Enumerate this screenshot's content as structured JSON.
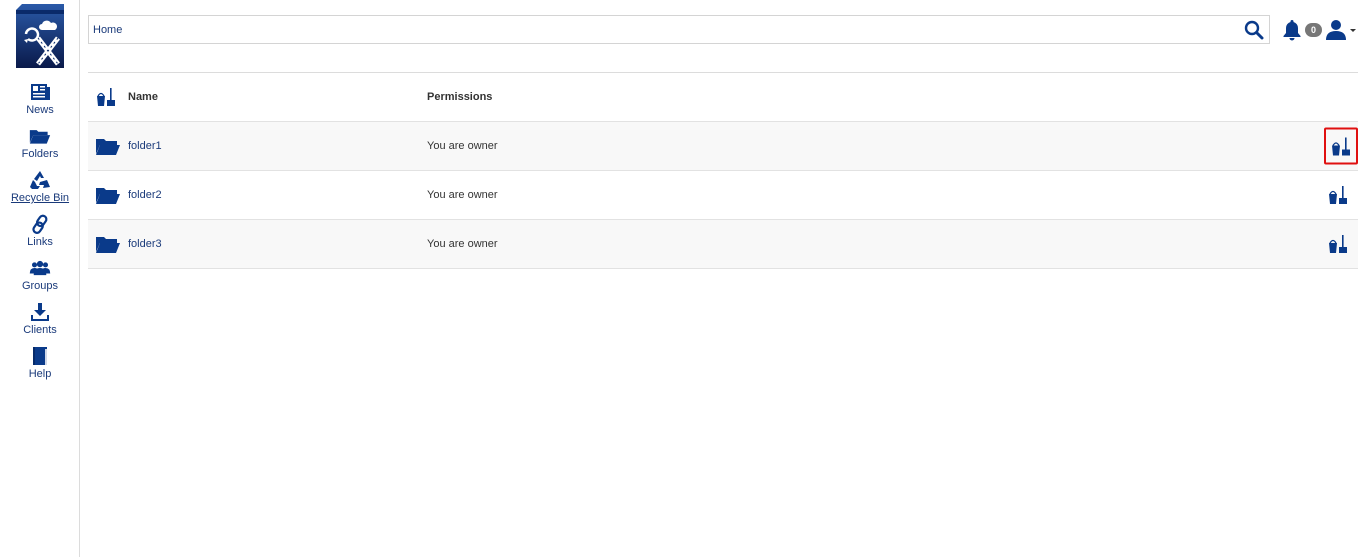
{
  "colors": {
    "brand": "#0a3a8a",
    "accent": "#e01010",
    "badge": "#777777"
  },
  "sidebar": {
    "logo_icon": "oxcloud-logo",
    "items": [
      {
        "label": "News",
        "icon": "news-icon"
      },
      {
        "label": "Folders",
        "icon": "folder-icon"
      },
      {
        "label": "Recycle Bin",
        "icon": "recycle-icon"
      },
      {
        "label": "Links",
        "icon": "link-icon"
      },
      {
        "label": "Groups",
        "icon": "groups-icon"
      },
      {
        "label": "Clients",
        "icon": "download-icon"
      },
      {
        "label": "Help",
        "icon": "book-icon"
      }
    ]
  },
  "header": {
    "breadcrumb": "Home",
    "notification_count": "0"
  },
  "table": {
    "columns": {
      "name": "Name",
      "permissions": "Permissions"
    },
    "rows": [
      {
        "name": "folder1",
        "permissions": "You are owner"
      },
      {
        "name": "folder2",
        "permissions": "You are owner"
      },
      {
        "name": "folder3",
        "permissions": "You are owner"
      }
    ]
  }
}
